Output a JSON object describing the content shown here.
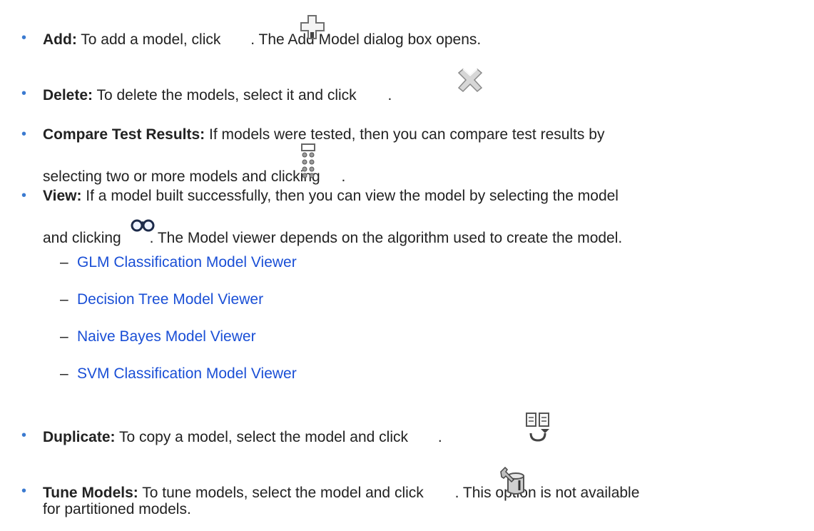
{
  "items": [
    {
      "term": "Add:",
      "before": " To add a model, click ",
      "after": ". The Add Model dialog box opens.",
      "icon": "add-plus-icon"
    },
    {
      "term": "Delete:",
      "before": " To delete the models, select it and click ",
      "after": ".",
      "icon": "delete-x-icon"
    },
    {
      "term": "Compare Test Results:",
      "line1": " If models were tested, then you can compare test results by",
      "line2_before": "selecting two or more models and clicking ",
      "after": ".",
      "icon": "compare-results-icon"
    },
    {
      "term": "View:",
      "line1": " If a model built successfully, then you can view the model by selecting the model",
      "line2_before": "and clicking ",
      "after": ". The Model viewer depends on the algorithm used to create the model.",
      "icon": "glasses-icon"
    },
    {
      "term": "Duplicate:",
      "before": " To copy a model, select the model and click ",
      "after": ".",
      "icon": "duplicate-icon"
    },
    {
      "term": "Tune Models:",
      "before": " To tune models, select the model and click ",
      "after": ". This option is not available",
      "line2": "for partitioned models.",
      "icon": "tune-wrench-icon"
    }
  ],
  "sublinks": [
    "GLM Classification Model Viewer",
    "Decision Tree Model Viewer",
    "Naive Bayes Model Viewer",
    "SVM Classification Model Viewer"
  ],
  "bullet_char": "•",
  "dash_char": "–",
  "colors": {
    "link": "#1a4fd6",
    "bullet": "#3b7ad0",
    "text": "#222222"
  }
}
